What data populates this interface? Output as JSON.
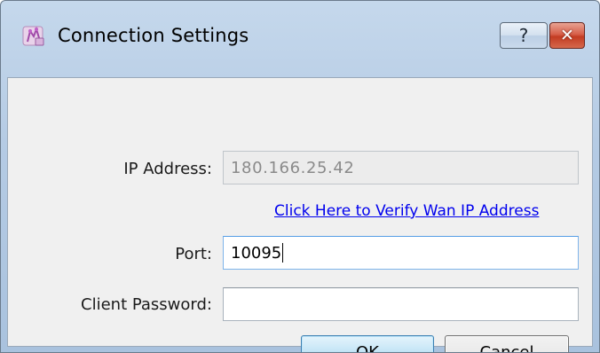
{
  "window": {
    "title": "Connection Settings",
    "help_label": "?",
    "close_label": "✕"
  },
  "form": {
    "ip_label": "IP Address:",
    "ip_value": "180.166.25.42",
    "verify_link": "Click Here to Verify Wan IP Address",
    "port_label": "Port:",
    "port_value": "10095",
    "password_label": "Client Password:",
    "password_value": ""
  },
  "buttons": {
    "ok": "OK",
    "cancel": "Cancel"
  },
  "icons": {
    "app": "app-icon",
    "help": "question-mark-icon",
    "close": "close-icon"
  }
}
